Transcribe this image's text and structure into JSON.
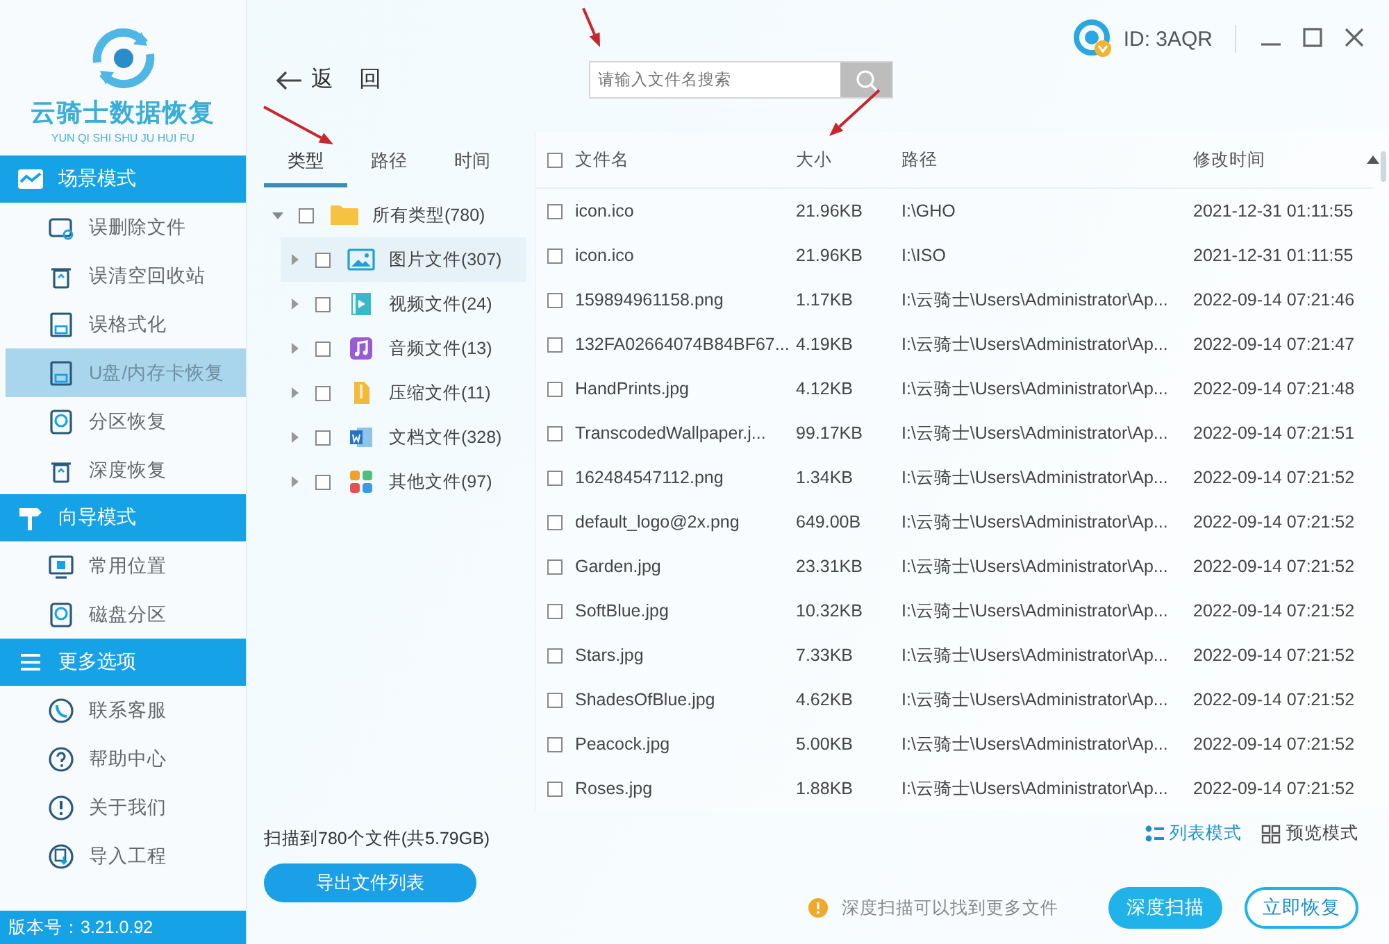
{
  "logo": {
    "title": "云骑士数据恢复",
    "subtitle": "YUN QI SHI SHU JU HUI FU"
  },
  "sidebar": {
    "sections": [
      {
        "title": "场景模式",
        "items": [
          {
            "label": "误删除文件",
            "selected": false
          },
          {
            "label": "误清空回收站",
            "selected": false
          },
          {
            "label": "误格式化",
            "selected": false
          },
          {
            "label": "U盘/内存卡恢复",
            "selected": true
          },
          {
            "label": "分区恢复",
            "selected": false
          },
          {
            "label": "深度恢复",
            "selected": false
          }
        ]
      },
      {
        "title": "向导模式",
        "items": [
          {
            "label": "常用位置",
            "selected": false
          },
          {
            "label": "磁盘分区",
            "selected": false
          }
        ]
      },
      {
        "title": "更多选项",
        "items": [
          {
            "label": "联系客服",
            "selected": false
          },
          {
            "label": "帮助中心",
            "selected": false
          },
          {
            "label": "关于我们",
            "selected": false
          },
          {
            "label": "导入工程",
            "selected": false
          }
        ]
      }
    ],
    "version": "版本号：3.21.0.92"
  },
  "toolbar": {
    "back": "返 回",
    "search": {
      "placeholder": "请输入文件名搜索"
    },
    "account_id": "ID: 3AQR"
  },
  "tree": {
    "tabs": [
      {
        "label": "类型",
        "selected": true
      },
      {
        "label": "路径",
        "selected": false
      },
      {
        "label": "时间",
        "selected": false
      }
    ],
    "items": [
      {
        "label": "所有类型(780)",
        "kind": "folder",
        "expanded": true,
        "checked": false,
        "selected": false,
        "children": [
          {
            "label": "图片文件(307)",
            "kind": "image",
            "expanded": false,
            "checked": false,
            "selected": true
          },
          {
            "label": "视频文件(24)",
            "kind": "video",
            "expanded": false,
            "checked": false,
            "selected": false
          },
          {
            "label": "音频文件(13)",
            "kind": "audio",
            "expanded": false,
            "checked": false,
            "selected": false
          },
          {
            "label": "压缩文件(11)",
            "kind": "archive",
            "expanded": false,
            "checked": false,
            "selected": false
          },
          {
            "label": "文档文件(328)",
            "kind": "document",
            "expanded": false,
            "checked": false,
            "selected": false
          },
          {
            "label": "其他文件(97)",
            "kind": "other",
            "expanded": false,
            "checked": false,
            "selected": false
          }
        ]
      }
    ],
    "summary": "扫描到780个文件(共5.79GB)",
    "export_button": "导出文件列表"
  },
  "table": {
    "all_checked": false,
    "columns": [
      {
        "label": "文件名",
        "sorted": false
      },
      {
        "label": "大小",
        "sorted": false
      },
      {
        "label": "路径",
        "sorted": false
      },
      {
        "label": "修改时间",
        "sorted": true
      }
    ],
    "rows": [
      {
        "name": "icon.ico",
        "size": "21.96KB",
        "path": "I:\\GHO",
        "modified": "2021-12-31 01:11:55",
        "checked": false
      },
      {
        "name": "icon.ico",
        "size": "21.96KB",
        "path": "I:\\ISO",
        "modified": "2021-12-31 01:11:55",
        "checked": false
      },
      {
        "name": "159894961158.png",
        "size": "1.17KB",
        "path": "I:\\云骑士\\Users\\Administrator\\Ap...",
        "modified": "2022-09-14 07:21:46",
        "checked": false
      },
      {
        "name": "132FA02664074B84BF67...",
        "size": "4.19KB",
        "path": "I:\\云骑士\\Users\\Administrator\\Ap...",
        "modified": "2022-09-14 07:21:47",
        "checked": false
      },
      {
        "name": "HandPrints.jpg",
        "size": "4.12KB",
        "path": "I:\\云骑士\\Users\\Administrator\\Ap...",
        "modified": "2022-09-14 07:21:48",
        "checked": false
      },
      {
        "name": "TranscodedWallpaper.j...",
        "size": "99.17KB",
        "path": "I:\\云骑士\\Users\\Administrator\\Ap...",
        "modified": "2022-09-14 07:21:51",
        "checked": false
      },
      {
        "name": "162484547112.png",
        "size": "1.34KB",
        "path": "I:\\云骑士\\Users\\Administrator\\Ap...",
        "modified": "2022-09-14 07:21:52",
        "checked": false
      },
      {
        "name": "default_logo@2x.png",
        "size": "649.00B",
        "path": "I:\\云骑士\\Users\\Administrator\\Ap...",
        "modified": "2022-09-14 07:21:52",
        "checked": false
      },
      {
        "name": "Garden.jpg",
        "size": "23.31KB",
        "path": "I:\\云骑士\\Users\\Administrator\\Ap...",
        "modified": "2022-09-14 07:21:52",
        "checked": false
      },
      {
        "name": "SoftBlue.jpg",
        "size": "10.32KB",
        "path": "I:\\云骑士\\Users\\Administrator\\Ap...",
        "modified": "2022-09-14 07:21:52",
        "checked": false
      },
      {
        "name": "Stars.jpg",
        "size": "7.33KB",
        "path": "I:\\云骑士\\Users\\Administrator\\Ap...",
        "modified": "2022-09-14 07:21:52",
        "checked": false
      },
      {
        "name": "ShadesOfBlue.jpg",
        "size": "4.62KB",
        "path": "I:\\云骑士\\Users\\Administrator\\Ap...",
        "modified": "2022-09-14 07:21:52",
        "checked": false
      },
      {
        "name": "Peacock.jpg",
        "size": "5.00KB",
        "path": "I:\\云骑士\\Users\\Administrator\\Ap...",
        "modified": "2022-09-14 07:21:52",
        "checked": false
      },
      {
        "name": "Roses.jpg",
        "size": "1.88KB",
        "path": "I:\\云骑士\\Users\\Administrator\\Ap...",
        "modified": "2022-09-14 07:21:52",
        "checked": false
      }
    ]
  },
  "view_modes": [
    {
      "label": "列表模式",
      "selected": true
    },
    {
      "label": "预览模式",
      "selected": false
    }
  ],
  "footer": {
    "hint": "深度扫描可以找到更多文件",
    "buttons": [
      {
        "label": "深度扫描",
        "kind": "primary"
      },
      {
        "label": "立即恢复",
        "kind": "outline"
      }
    ]
  }
}
